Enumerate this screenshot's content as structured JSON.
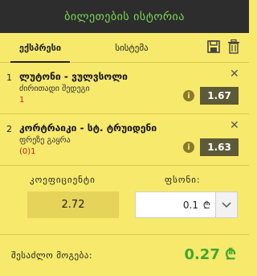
{
  "header": {
    "title": "ბილეთების ისტორია"
  },
  "tabs": [
    {
      "label": "ექსპრესი",
      "active": true
    },
    {
      "label": "სისტემა",
      "active": false
    }
  ],
  "toolbar": {
    "save_icon": "save-icon",
    "delete_icon": "trash-icon"
  },
  "bets": [
    {
      "index": "1",
      "match": "ლუტონი - ვულვსოლი",
      "market": "ძირითადი შედეგი",
      "pick": "1",
      "odds": "1.67"
    },
    {
      "index": "2",
      "match": "კორტრაიკი - სტ. ტრუიდენი",
      "market": "ფრეზე გაყრა",
      "pick": "(0)1",
      "odds": "1.63"
    }
  ],
  "summary": {
    "coef_label": "კოეფიციენტი",
    "coef_value": "2.72",
    "stake_label": "ფსონი:",
    "stake_value": "0.1",
    "currency": "₾",
    "win_label": "შესაძლო მოგება:",
    "win_value": "0.27 ₾"
  },
  "colors": {
    "background": "#f7e96b",
    "header": "#2d2d2d",
    "accent_green": "#7ed957",
    "win_green": "#3ea82e",
    "odds_bg": "#5c5a38",
    "pick_red": "#c0222b"
  }
}
